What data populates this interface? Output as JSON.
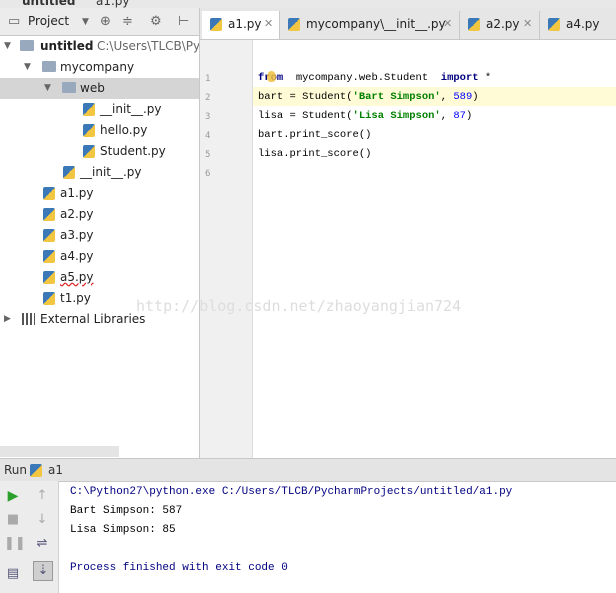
{
  "breadcrumb": {
    "project": "untitled",
    "file": "a1.py"
  },
  "project_panel": {
    "label": "Project",
    "tree": [
      {
        "label": "untitled",
        "path": "C:\\Users\\TLCB\\Py"
      },
      {
        "label": "mycompany"
      },
      {
        "label": "web"
      },
      {
        "label": "__init__.py"
      },
      {
        "label": "hello.py"
      },
      {
        "label": "Student.py"
      },
      {
        "label": "__init__.py"
      },
      {
        "label": "a1.py"
      },
      {
        "label": "a2.py"
      },
      {
        "label": "a3.py"
      },
      {
        "label": "a4.py"
      },
      {
        "label": "a5.py"
      },
      {
        "label": "t1.py"
      },
      {
        "label": "External Libraries"
      }
    ]
  },
  "tabs": [
    {
      "label": "a1.py"
    },
    {
      "label": "mycompany\\__init__.py"
    },
    {
      "label": "a2.py"
    },
    {
      "label": "a4.py"
    }
  ],
  "editor": {
    "line_numbers": [
      "1",
      "2",
      "3",
      "4",
      "5",
      "6"
    ],
    "lines": [
      {
        "kw1": "from",
        "mod": "mycompany.web.Student",
        "kw2": "import",
        "rest": "*"
      },
      {
        "pre": "bart = Student(",
        "str": "'Bart Simpson'",
        "mid": ", ",
        "num": "589",
        "post": ")"
      },
      {
        "pre": "lisa = Student(",
        "str": "'Lisa Simpson'",
        "mid": ", ",
        "num": "87",
        "post": ")"
      },
      {
        "text": "bart.print_score()"
      },
      {
        "text": "lisa.print_score()"
      }
    ],
    "watermark": "http://blog.csdn.net/zhaoyangjian724"
  },
  "run": {
    "label": "Run",
    "config": "a1",
    "output": [
      "C:\\Python27\\python.exe C:/Users/TLCB/PycharmProjects/untitled/a1.py",
      "Bart Simpson: 587",
      "Lisa Simpson: 85",
      "Process finished with exit code 0"
    ]
  }
}
